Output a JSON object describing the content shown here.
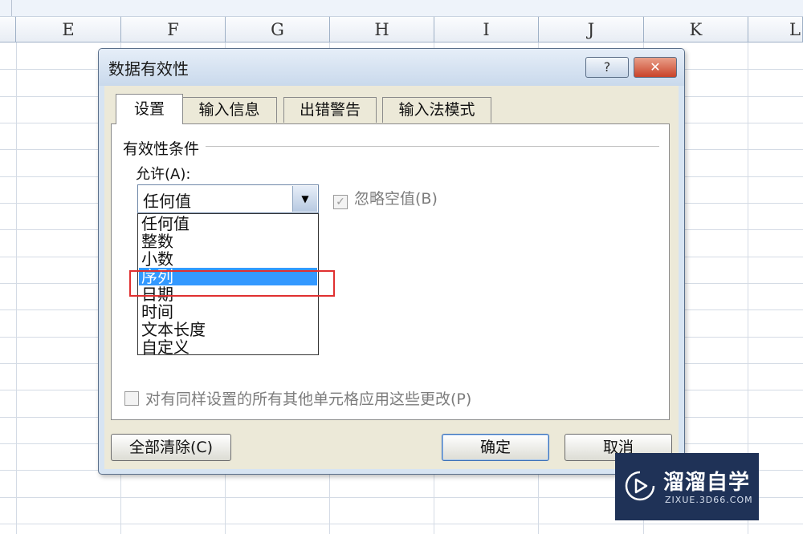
{
  "spreadsheet": {
    "columns": [
      "E",
      "F",
      "G",
      "H",
      "I",
      "J",
      "K",
      "L"
    ]
  },
  "dialog": {
    "title": "数据有效性",
    "help_label": "?",
    "close_label": "✕",
    "tabs": [
      {
        "label": "设置",
        "active": true
      },
      {
        "label": "输入信息",
        "active": false
      },
      {
        "label": "出错警告",
        "active": false
      },
      {
        "label": "输入法模式",
        "active": false
      }
    ],
    "settings": {
      "group_label": "有效性条件",
      "allow_label": "允许(A):",
      "allow_value": "任何值",
      "allow_options": [
        "任何值",
        "整数",
        "小数",
        "序列",
        "日期",
        "时间",
        "文本长度",
        "自定义"
      ],
      "highlighted_option": "序列",
      "ignore_blank_label": "忽略空值(B)",
      "ignore_blank_checked": true,
      "apply_all_label": "对有同样设置的所有其他单元格应用这些更改(P)",
      "apply_all_checked": false
    },
    "buttons": {
      "clear_all": "全部清除(C)",
      "ok": "确定",
      "cancel": "取消"
    }
  },
  "watermark": {
    "name": "溜溜自学",
    "url": "ZIXUE.3D66.COM"
  }
}
